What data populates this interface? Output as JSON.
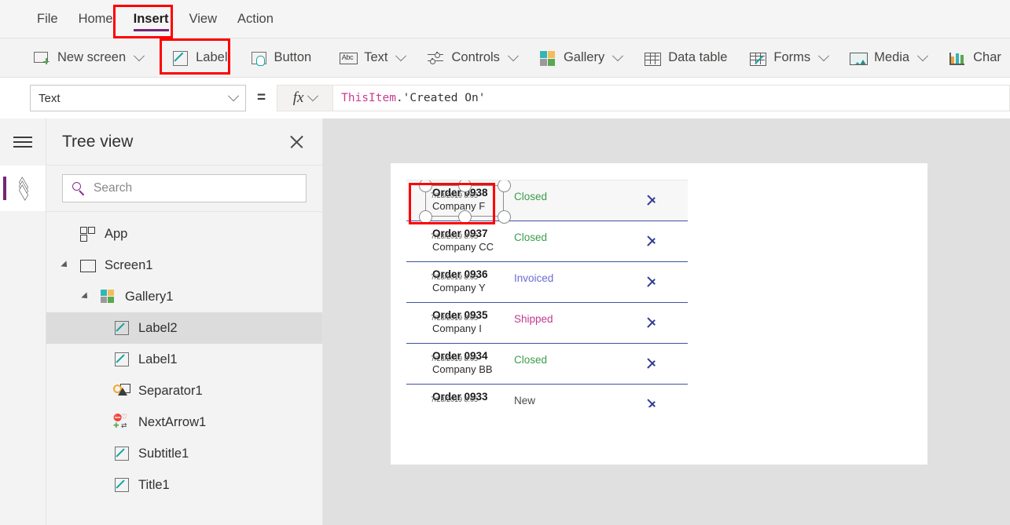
{
  "menu": {
    "items": [
      {
        "label": "File",
        "active": false
      },
      {
        "label": "Home",
        "active": false
      },
      {
        "label": "Insert",
        "active": true
      },
      {
        "label": "View",
        "active": false
      },
      {
        "label": "Action",
        "active": false
      }
    ]
  },
  "ribbon": {
    "items": [
      {
        "label": "New screen",
        "icon": "new-screen-icon",
        "caret": true
      },
      {
        "label": "Label",
        "icon": "label-icon",
        "caret": false
      },
      {
        "label": "Button",
        "icon": "button-icon",
        "caret": false
      },
      {
        "label": "Text",
        "icon": "text-abc-icon",
        "caret": true
      },
      {
        "label": "Controls",
        "icon": "controls-sliders-icon",
        "caret": true
      },
      {
        "label": "Gallery",
        "icon": "gallery-icon",
        "caret": true
      },
      {
        "label": "Data table",
        "icon": "data-table-icon",
        "caret": false
      },
      {
        "label": "Forms",
        "icon": "forms-icon",
        "caret": true
      },
      {
        "label": "Media",
        "icon": "media-icon",
        "caret": true
      },
      {
        "label": "Char",
        "icon": "chart-icon",
        "caret": false
      }
    ]
  },
  "formula_bar": {
    "property": "Text",
    "equals": "=",
    "fx_label": "fx",
    "formula_object": "ThisItem",
    "formula_rest": ".'Created On'"
  },
  "left_rail": {
    "hamburger": "hamburger-icon",
    "active_tool": "tree-view-layers-icon"
  },
  "tree_panel": {
    "title": "Tree view",
    "close": "close-icon",
    "search": {
      "placeholder": "Search",
      "value": "",
      "icon": "search-icon"
    },
    "items": [
      {
        "label": "App",
        "indent": 0,
        "twisty": false,
        "icon": "app-icon",
        "selected": false
      },
      {
        "label": "Screen1",
        "indent": 1,
        "twisty": true,
        "icon": "screen-icon",
        "selected": false
      },
      {
        "label": "Gallery1",
        "indent": 2,
        "twisty": true,
        "icon": "gallery-icon",
        "selected": false
      },
      {
        "label": "Label2",
        "indent": 3,
        "twisty": false,
        "icon": "label-icon",
        "selected": true
      },
      {
        "label": "Label1",
        "indent": 3,
        "twisty": false,
        "icon": "label-icon",
        "selected": false
      },
      {
        "label": "Separator1",
        "indent": 3,
        "twisty": false,
        "icon": "separator-icon",
        "selected": false
      },
      {
        "label": "NextArrow1",
        "indent": 3,
        "twisty": false,
        "icon": "next-arrow-icon",
        "selected": false
      },
      {
        "label": "Subtitle1",
        "indent": 3,
        "twisty": false,
        "icon": "label-icon",
        "selected": false
      },
      {
        "label": "Title1",
        "indent": 3,
        "twisty": false,
        "icon": "label-icon",
        "selected": false
      }
    ]
  },
  "canvas": {
    "gallery_rows": [
      {
        "title": "Order 0938",
        "subtitle": "Company F",
        "date": "7/28/2019 8:05",
        "status": "Closed",
        "status_kind": "closed",
        "selected": true
      },
      {
        "title": "Order 0937",
        "subtitle": "Company CC",
        "date": "7/28/2019 8:05",
        "status": "Closed",
        "status_kind": "closed",
        "selected": false
      },
      {
        "title": "Order 0936",
        "subtitle": "Company Y",
        "date": "7/28/2019 8:05",
        "status": "Invoiced",
        "status_kind": "invoiced",
        "selected": false
      },
      {
        "title": "Order 0935",
        "subtitle": "Company I",
        "date": "7/28/2019 8:05",
        "status": "Shipped",
        "status_kind": "shipped",
        "selected": false
      },
      {
        "title": "Order 0934",
        "subtitle": "Company BB",
        "date": "7/28/2019 8:05",
        "status": "Closed",
        "status_kind": "closed",
        "selected": false
      },
      {
        "title": "Order 0933",
        "subtitle": "",
        "date": "7/28/2019 8:05",
        "status": "New",
        "status_kind": "new",
        "selected": false
      }
    ]
  },
  "colors": {
    "accent_purple": "#742774",
    "annotation_red": "#ff0000",
    "status_closed": "#3a9d4a",
    "status_invoiced": "#6b6bd6",
    "status_shipped": "#c23a8f",
    "status_new": "#4a4a4a",
    "chevron_navy": "#2f3b8f"
  }
}
